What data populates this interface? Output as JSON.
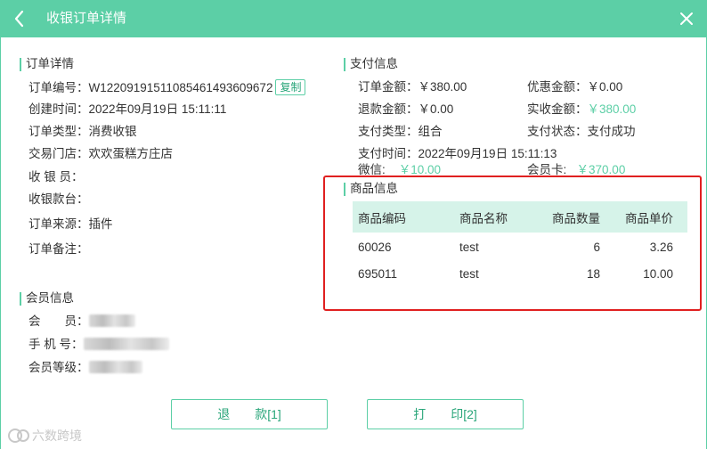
{
  "header": {
    "title": "收银订单详情"
  },
  "order": {
    "section_title": "订单详情",
    "fields": [
      {
        "label": "订单编号：",
        "value": "W1220919151108546149360967​2"
      },
      {
        "label": "创建时间：",
        "value": "2022年09月19日 15:11:11"
      },
      {
        "label": "订单类型：",
        "value": "消费收银"
      },
      {
        "label": "交易门店：",
        "value": "欢欢蛋糕方庄店"
      },
      {
        "label": "收 银 员：",
        "value": ""
      },
      {
        "label": "收银款台：",
        "value": ""
      },
      {
        "label": "订单来源：",
        "value": "插件"
      },
      {
        "label": "订单备注：",
        "value": ""
      }
    ],
    "copy_label": "复制"
  },
  "payment": {
    "section_title": "支付信息",
    "left": [
      {
        "label": "订单金额：",
        "value": "￥380.00"
      },
      {
        "label": "退款金额：",
        "value": "￥0.00"
      },
      {
        "label": "支付类型：",
        "value": "组合"
      },
      {
        "label": "支付时间：",
        "value": "2022年09月19日 15:11:13"
      },
      {
        "label": "微信:",
        "value": "￥10.00"
      }
    ],
    "right": [
      {
        "label": "优惠金额：",
        "value": "￥0.00"
      },
      {
        "label": "实收金额：",
        "value": "￥380.00"
      },
      {
        "label": "支付状态：",
        "value": "支付成功"
      },
      {
        "label": "会员卡:",
        "value": "￥370.00"
      }
    ]
  },
  "goods": {
    "section_title": "商品信息",
    "columns": [
      "商品编码",
      "商品名称",
      "商品数量",
      "商品单价"
    ],
    "rows": [
      [
        "60026",
        "test",
        "6",
        "3.26"
      ],
      [
        "695011",
        "test",
        "18",
        "10.00"
      ]
    ]
  },
  "member": {
    "section_title": "会员信息",
    "fields": [
      {
        "label": "会　　员："
      },
      {
        "label": "手 机 号："
      },
      {
        "label": "会员等级："
      }
    ]
  },
  "buttons": {
    "refund": "退　　款[1]",
    "print": "打　　印[2]"
  },
  "watermark": {
    "text": "六数跨境"
  },
  "colors": {
    "accent": "#5ccfa6",
    "highlight_border": "#e02020",
    "table_header": "#d6f3e9"
  },
  "icons": {
    "back": "chevron-left-icon",
    "close": "close-icon",
    "watermark": "brand-logo-icon"
  }
}
